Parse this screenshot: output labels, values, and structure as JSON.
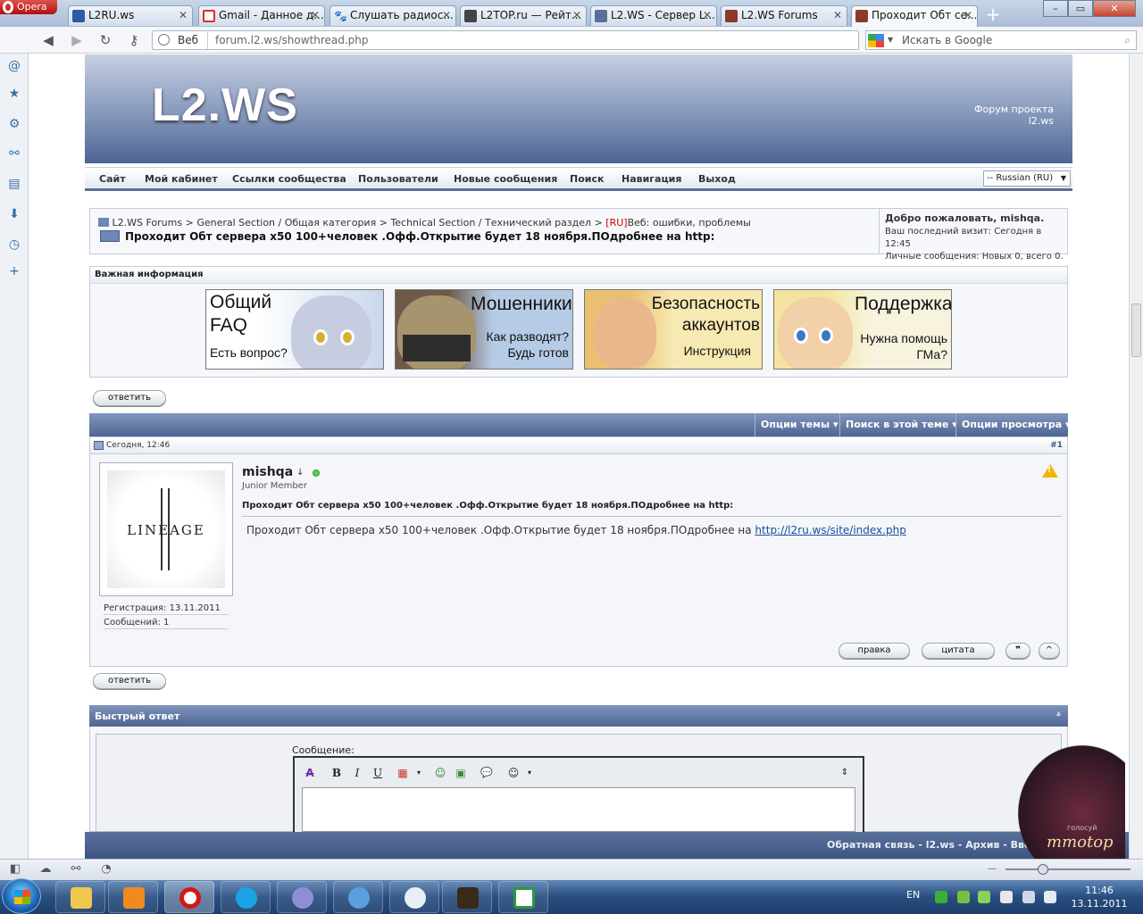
{
  "browser": {
    "app_name": "Opera",
    "tabs": [
      {
        "label": "L2RU.ws",
        "favicon_color": "#2b5aa8"
      },
      {
        "label": "Gmail - Данное д...",
        "favicon_color": "#d93025"
      },
      {
        "label": "Слушать радиос...",
        "favicon_color": "#333333"
      },
      {
        "label": "L2TOP.ru — Рейт...",
        "favicon_color": "#444444"
      },
      {
        "label": "L2.WS - Сервер L...",
        "favicon_color": "#5a6f99"
      },
      {
        "label": "L2.WS Forums",
        "favicon_color": "#8a3a2a"
      },
      {
        "label": "Проходит Обт се...",
        "favicon_color": "#8a3a2a"
      }
    ],
    "new_tab": "+",
    "url_mode": "Веб",
    "url": "forum.l2.ws/showthread.php",
    "search_placeholder": "Искать в Google"
  },
  "header": {
    "logo": "L2.WS",
    "tagline": "Форум проекта l2.ws"
  },
  "nav": {
    "items": [
      "Сайт",
      "Мой кабинет",
      "Ссылки сообщества",
      "Пользователи",
      "Новые сообщения",
      "Поиск",
      "Навигация",
      "Выход"
    ],
    "language": "-- Russian (RU)"
  },
  "breadcrumb": {
    "parts": [
      "L2.WS Forums",
      ">",
      "General Section / Общая категория",
      ">",
      "Technical Section / Технический раздел",
      ">"
    ],
    "prefix": "[RU]",
    "last": "Веб: ошибки, проблемы",
    "thread_title": "Проходит Обт сервера x50 100+человек .Офф.Открытие будет 18 ноября.ПОдробнее на http:"
  },
  "welcome": {
    "title": "Добро пожаловать, mishqa.",
    "last_visit": "Ваш последний визит: Сегодня в 12:45",
    "pm": "Личные сообщения: Новых 0, всего 0."
  },
  "important": {
    "heading": "Важная информация",
    "banners": [
      {
        "line1": "Общий",
        "line2": "FAQ",
        "line3": "Есть вопрос?",
        "bg": "#c9d7ec"
      },
      {
        "line1": "Мошенники",
        "line2": "Как разводят?",
        "line3": "Будь готов",
        "bg": "#b6cbe6"
      },
      {
        "line1": "Безопасность",
        "line2": "аккаунтов",
        "line3": "Инструкция",
        "bg": "#f2d98a"
      },
      {
        "line1": "Поддержка",
        "line2": "Нужна помощь",
        "line3": "ГМа?",
        "bg": "#f3ecd0"
      }
    ]
  },
  "buttons": {
    "reply": "ответить",
    "edit": "правка",
    "quote": "цитата",
    "multiquote": "❞",
    "top": "^"
  },
  "post": {
    "options": [
      "Опции темы ▾",
      "Поиск в этой теме ▾",
      "Опции просмотра ▾"
    ],
    "date": "Сегодня, 12:46",
    "number": "#1",
    "username": "mishqa",
    "user_arrow": "↓",
    "rank": "Junior Member",
    "avatar_text": "LINEAGE",
    "registration": "Регистрация: 13.11.2011",
    "messages": "Сообщений: 1",
    "title": "Проходит Обт сервера x50 100+человек .Офф.Открытие будет 18 ноября.ПОдробнее на http:",
    "body": "Проходит Обт сервера x50 100+человек .Офф.Открытие будет 18 ноября.ПОдробнее на",
    "link": "http://l2ru.ws/site/index.php",
    "warn": "!"
  },
  "quick_reply": {
    "title": "Быстрый ответ",
    "collapse": "⩓",
    "message_label": "Сообщение:",
    "tools": [
      "A",
      "B",
      "I",
      "U",
      "▦",
      "▾",
      "☺",
      "▣",
      "💬",
      "☺",
      "▾",
      "⇕"
    ]
  },
  "footer": {
    "text": "Обратная связь - l2.ws - Архив - Ввер"
  },
  "mmotop": {
    "text": "mmotop",
    "subtext": "голосуй"
  },
  "taskbar": {
    "lang": "EN",
    "time": "11:46",
    "date": "13.11.2011"
  }
}
